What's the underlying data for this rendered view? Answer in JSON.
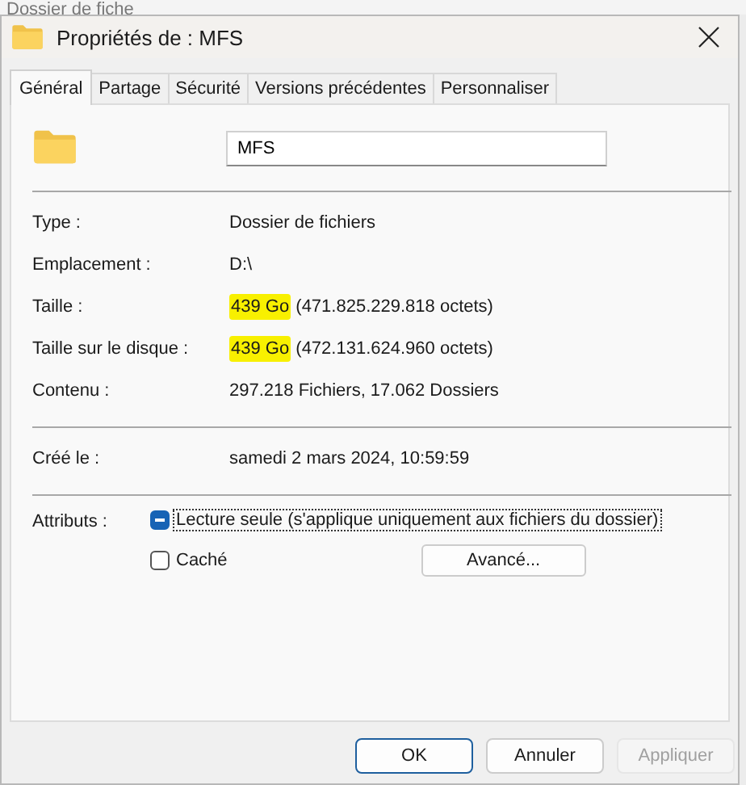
{
  "background_window": {
    "title": "Dossier de fiche"
  },
  "window": {
    "title": "Propriétés de : MFS"
  },
  "tabs": [
    {
      "label": "Général",
      "selected": true
    },
    {
      "label": "Partage",
      "selected": false
    },
    {
      "label": "Sécurité",
      "selected": false
    },
    {
      "label": "Versions précédentes",
      "selected": false
    },
    {
      "label": "Personnaliser",
      "selected": false
    }
  ],
  "name_field": {
    "value": "MFS"
  },
  "sections": [
    [
      {
        "label": "Type :",
        "value": "Dossier de fichiers"
      },
      {
        "label": "Emplacement :",
        "value": "D:\\"
      },
      {
        "label": "Taille :",
        "value": "439 Go",
        "detail": "(471.825.229.818 octets)",
        "highlighted": true
      },
      {
        "label": "Taille sur le disque :",
        "value": "439 Go",
        "detail": "(472.131.624.960 octets)",
        "highlighted": true
      },
      {
        "label": "Contenu :",
        "value": "297.218 Fichiers, 17.062 Dossiers"
      }
    ],
    [
      {
        "label": "Créé le :",
        "value": "samedi 2 mars 2024, 10:59:59"
      }
    ]
  ],
  "attributes": {
    "label": "Attributs :",
    "read_only": {
      "label": "Lecture seule (s'applique uniquement aux fichiers du dossier)",
      "indeterminate": true,
      "focused": true
    },
    "hidden": {
      "label": "Caché",
      "checked": false,
      "indeterminate": false,
      "focused": false
    },
    "advanced_button": "Avancé..."
  },
  "buttons": [
    {
      "label": "OK",
      "default": true,
      "disabled": false
    },
    {
      "label": "Annuler",
      "default": false,
      "disabled": false
    },
    {
      "label": "Appliquer",
      "default": false,
      "disabled": true
    }
  ]
}
